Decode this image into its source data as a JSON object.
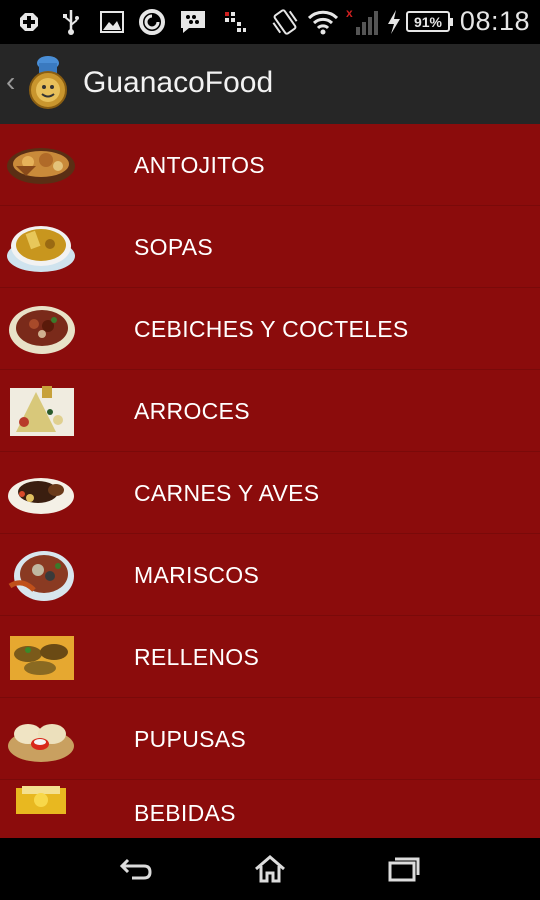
{
  "status_bar": {
    "icons": [
      "add-icon",
      "usb-icon",
      "image-icon",
      "sync-icon",
      "bbm-icon",
      "sim-icon",
      "vibrate-icon",
      "wifi-icon",
      "signal-icon",
      "charging-icon"
    ],
    "battery": "91%",
    "time": "08:18"
  },
  "action_bar": {
    "title": "GuanacoFood"
  },
  "menu": {
    "items": [
      {
        "label": "ANTOJITOS"
      },
      {
        "label": "SOPAS"
      },
      {
        "label": "CEBICHES Y COCTELES"
      },
      {
        "label": "ARROCES"
      },
      {
        "label": "CARNES Y AVES"
      },
      {
        "label": "MARISCOS"
      },
      {
        "label": "RELLENOS"
      },
      {
        "label": "PUPUSAS"
      },
      {
        "label": "BEBIDAS"
      }
    ]
  },
  "nav_bar": {
    "buttons": [
      "back-icon",
      "home-icon",
      "recent-apps-icon"
    ]
  },
  "colors": {
    "list_background": "#8b0c0c",
    "action_bar": "#262626",
    "status_bar": "#000000"
  }
}
